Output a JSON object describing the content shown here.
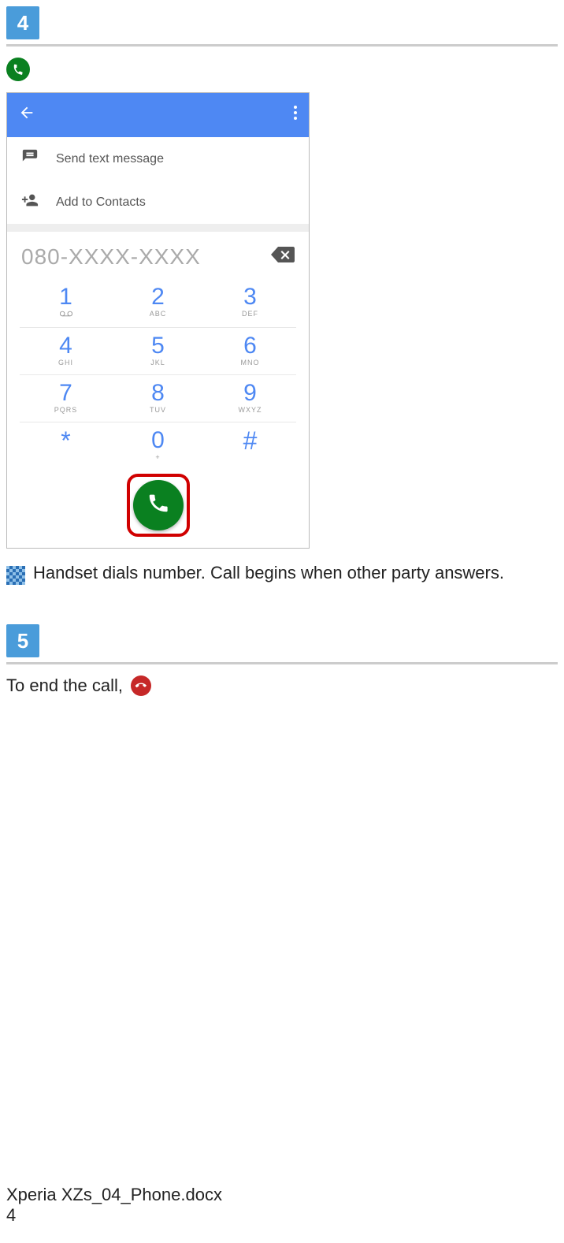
{
  "step4": {
    "number": "4"
  },
  "dialer": {
    "send_text_label": "Send text message",
    "add_contacts_label": "Add to Contacts",
    "number_display": "080-XXXX-XXXX",
    "keys": [
      {
        "digit": "1",
        "letters": ""
      },
      {
        "digit": "2",
        "letters": "ABC"
      },
      {
        "digit": "3",
        "letters": "DEF"
      },
      {
        "digit": "4",
        "letters": "GHI"
      },
      {
        "digit": "5",
        "letters": "JKL"
      },
      {
        "digit": "6",
        "letters": "MNO"
      },
      {
        "digit": "7",
        "letters": "PQRS"
      },
      {
        "digit": "8",
        "letters": "TUV"
      },
      {
        "digit": "9",
        "letters": "WXYZ"
      },
      {
        "digit": "*",
        "letters": ""
      },
      {
        "digit": "0",
        "letters": "+"
      },
      {
        "digit": "#",
        "letters": ""
      }
    ]
  },
  "result_text": "Handset dials number. Call begins when other party answers.",
  "step5": {
    "number": "5"
  },
  "end_call_text": "To end the call,",
  "footer": {
    "filename": "Xperia XZs_04_Phone.docx",
    "page_number": "4"
  }
}
